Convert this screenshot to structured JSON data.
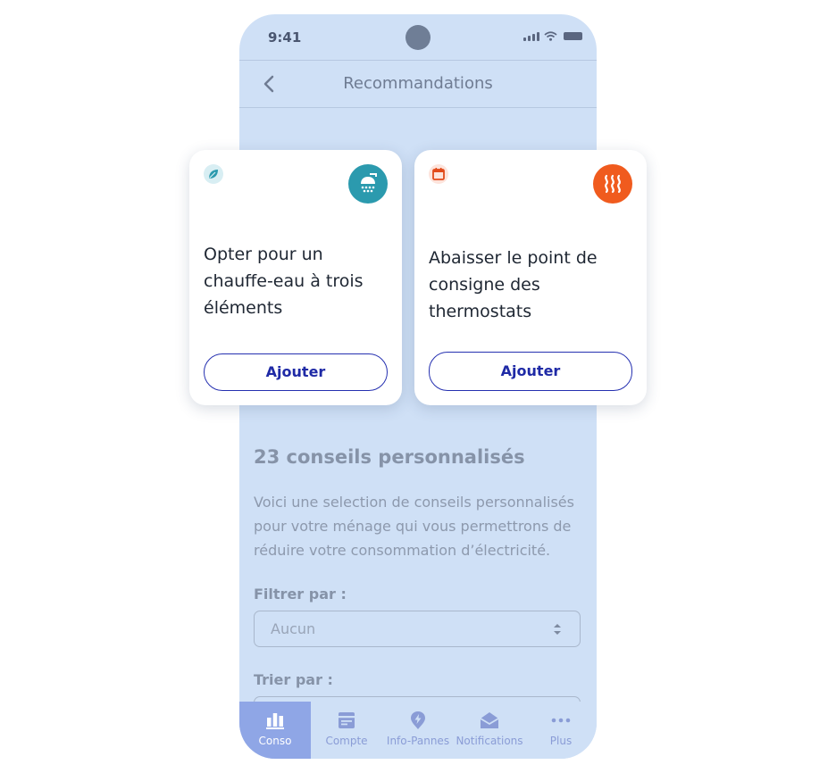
{
  "status_bar": {
    "time": "9:41"
  },
  "nav": {
    "title": "Recommandations"
  },
  "cards": [
    {
      "title": "Opter pour un chauffe-eau à trois éléments",
      "button": "Ajouter",
      "tag_icon": "leaf-icon",
      "category_icon": "shower-icon",
      "tag_color": "#2b9aae",
      "category_color": "#2b9aae"
    },
    {
      "title": "Abaisser le point de consigne des thermostats",
      "button": "Ajouter",
      "tag_icon": "calendar-icon",
      "category_icon": "heat-icon",
      "tag_color": "#e24a1a",
      "category_color": "#f05b1e"
    }
  ],
  "main": {
    "section_title": "23 conseils personnalisés",
    "description": "Voici une selection de conseils personnalisés pour votre ménage qui vous permettrons de réduire votre consommation d’électricité.",
    "filter": {
      "label": "Filtrer par :",
      "value": "Aucun"
    },
    "sort": {
      "label": "Trier par :"
    }
  },
  "tabs": [
    {
      "label": "Conso",
      "icon": "chart-icon",
      "active": true
    },
    {
      "label": "Compte",
      "icon": "bill-icon",
      "active": false
    },
    {
      "label": "Info-Pannes",
      "icon": "lightning-icon",
      "active": false
    },
    {
      "label": "Notifications",
      "icon": "envelope-icon",
      "active": false
    },
    {
      "label": "Plus",
      "icon": "more-icon",
      "active": false
    }
  ],
  "colors": {
    "accent": "#1f2aa6",
    "phone_bg": "#cfe0f6",
    "active_tab": "#8fa6e6"
  }
}
